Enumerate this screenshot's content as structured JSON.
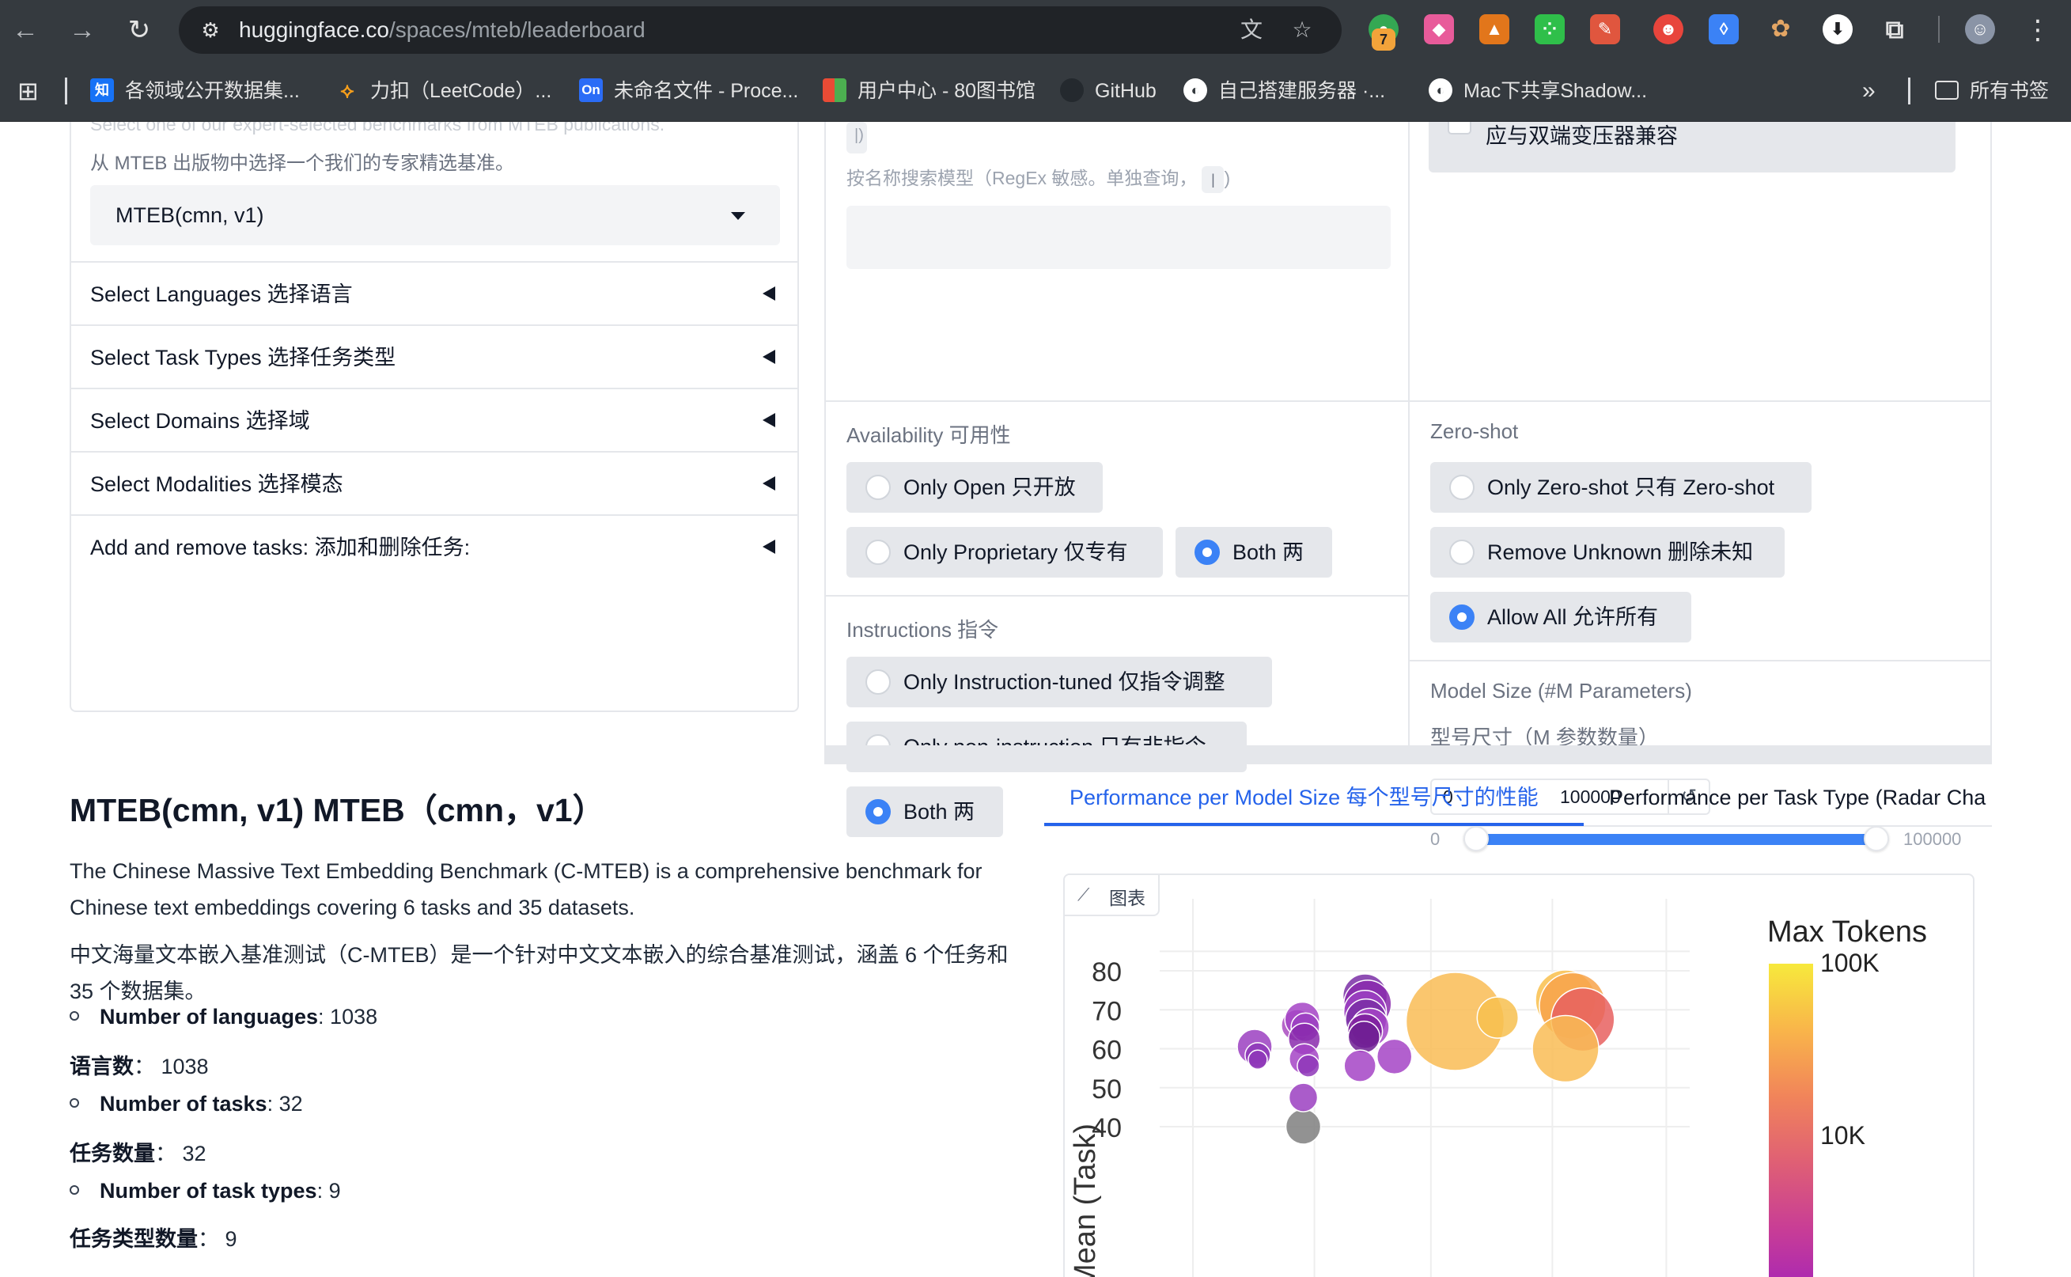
{
  "browser": {
    "url_host": "huggingface.co",
    "url_path": "/spaces/mteb/leaderboard",
    "extension_badge": "7",
    "bookmarks": [
      {
        "label": "各领域公开数据集...",
        "icon": "知",
        "color": "#1772f6"
      },
      {
        "label": "力扣（LeetCode）...",
        "icon": "⟡",
        "color": "#f89f1b"
      },
      {
        "label": "未命名文件 - Proce...",
        "icon": "On",
        "color": "#2b6cf6"
      },
      {
        "label": "用户中心 - 80图书馆",
        "icon": "▦",
        "color": "#e94b35"
      },
      {
        "label": "GitHub",
        "icon": "●",
        "color": "#24292e"
      },
      {
        "label": "自己搭建服务器 ·...",
        "icon": "◐",
        "color": "#ffffff"
      },
      {
        "label": "Mac下共享Shadow...",
        "icon": "◐",
        "color": "#ffffff"
      }
    ],
    "all_bookmarks": "所有书签"
  },
  "left": {
    "faded_info": "Select one of our expert-selected benchmarks from MTEB publications.",
    "info_cn": "从 MTEB 出版物中选择一个我们的专家精选基准。",
    "benchmark_value": "MTEB(cmn, v1)",
    "accordions": [
      "Select Languages  选择语言",
      "Select Task Types  选择任务类型",
      "Select Domains  选择域",
      "Select Modalities  选择模态",
      "Add and remove tasks:  添加和删除任务:"
    ]
  },
  "filters": {
    "search_info": "按名称搜索模型（RegEx 敏感。单独查询，",
    "search_kbd": "|",
    "search_tail": ")",
    "compat_label": "应与双端变压器兼容",
    "availability": {
      "label": "Availability  可用性",
      "options": [
        "Only Open  只开放",
        "Only Proprietary  仅专有",
        "Both  两"
      ],
      "selected": "Both  两"
    },
    "instructions": {
      "label": "Instructions  指令",
      "options": [
        "Only Instruction-tuned  仅指令调整",
        "Only non-instruction  只有非指令",
        "Both  两"
      ],
      "selected": "Both  两"
    },
    "zeroshot": {
      "label": "Zero-shot",
      "options": [
        "Only Zero-shot  只有 Zero-shot",
        "Remove Unknown  删除未知",
        "Allow All  允许所有"
      ],
      "selected": "Allow All  允许所有"
    },
    "model_size": {
      "label": "Model Size (#M Parameters)",
      "label_cn": "型号尺寸（M 参数数量）",
      "min": "0",
      "max": "100000",
      "slider_min_label": "0",
      "slider_max_label": "100000"
    }
  },
  "content": {
    "title": "MTEB(cmn, v1)  MTEB（cmn，v1）",
    "desc_en": "The Chinese Massive Text Embedding Benchmark (C-MTEB) is a comprehensive benchmark for Chinese text embeddings covering 6 tasks and 35 datasets.",
    "desc_cn": "中文海量文本嵌入基准测试（C-MTEB）是一个针对中文文本嵌入的综合基准测试，涵盖 6 个任务和 35 个数据集。",
    "stats": [
      {
        "label": "Number of languages",
        "value": ": 1038",
        "cn_label": "语言数",
        "cn_value": "： 1038"
      },
      {
        "label": "Number of tasks",
        "value": ": 32",
        "cn_label": "任务数量",
        "cn_value": "： 32"
      },
      {
        "label": "Number of task types",
        "value": ": 9",
        "cn_label": "任务类型数量",
        "cn_value": "： 9"
      }
    ]
  },
  "tabs": [
    {
      "label": "Performance per Model Size  每个型号尺寸的性能",
      "active": true
    },
    {
      "label": "Performance per Task Type (Radar Cha",
      "active": false
    }
  ],
  "chart_badge": "图表",
  "chart_data": {
    "type": "scatter",
    "ylabel": "Mean (Task)",
    "yticks": [
      40,
      50,
      60,
      70,
      80
    ],
    "ylim": [
      32,
      86
    ],
    "colorbar": {
      "title": "Max Tokens",
      "ticks": [
        "100K",
        "10K"
      ],
      "colors": [
        "#f7e93c",
        "#f9b54a",
        "#f1845a",
        "#df5f75",
        "#c83d96",
        "#a524b8"
      ]
    },
    "points": [
      {
        "xf": 0.268,
        "y": 40,
        "r": 22,
        "color": "#7f7f7f"
      },
      {
        "xf": 0.268,
        "y": 47.5,
        "r": 18,
        "color": "#9b3fc1"
      },
      {
        "xf": 0.172,
        "y": 60.5,
        "r": 22,
        "color": "#9b3fc1"
      },
      {
        "xf": 0.178,
        "y": 58.3,
        "r": 16,
        "color": "#8e37b9"
      },
      {
        "xf": 0.178,
        "y": 57.2,
        "r": 12,
        "color": "#8e37b9"
      },
      {
        "xf": 0.256,
        "y": 66,
        "r": 20,
        "color": "#a94bbf"
      },
      {
        "xf": 0.266,
        "y": 67.5,
        "r": 22,
        "color": "#a444c5"
      },
      {
        "xf": 0.272,
        "y": 65.5,
        "r": 18,
        "color": "#9b3fc1"
      },
      {
        "xf": 0.27,
        "y": 62.5,
        "r": 20,
        "color": "#8a2aad"
      },
      {
        "xf": 0.27,
        "y": 57.4,
        "r": 19,
        "color": "#a444c5"
      },
      {
        "xf": 0.278,
        "y": 55.6,
        "r": 14,
        "color": "#8e37b9"
      },
      {
        "xf": 0.39,
        "y": 73.5,
        "r": 28,
        "color": "#7a2fa6"
      },
      {
        "xf": 0.395,
        "y": 71.5,
        "r": 30,
        "color": "#8a2aad"
      },
      {
        "xf": 0.39,
        "y": 69.5,
        "r": 27,
        "color": "#9b3fc1"
      },
      {
        "xf": 0.392,
        "y": 67.5,
        "r": 26,
        "color": "#7a2fa6"
      },
      {
        "xf": 0.4,
        "y": 65.5,
        "r": 24,
        "color": "#a444c5"
      },
      {
        "xf": 0.39,
        "y": 64.5,
        "r": 22,
        "color": "#7d1f9c"
      },
      {
        "xf": 0.388,
        "y": 63,
        "r": 20,
        "color": "#6f1e93"
      },
      {
        "xf": 0.38,
        "y": 55.6,
        "r": 20,
        "color": "#a444c5"
      },
      {
        "xf": 0.448,
        "y": 58,
        "r": 22,
        "color": "#a444c5"
      },
      {
        "xf": 0.568,
        "y": 67,
        "r": 62,
        "color": "#f9bc55"
      },
      {
        "xf": 0.652,
        "y": 68,
        "r": 26,
        "color": "#f7c04f"
      },
      {
        "xf": 0.786,
        "y": 72.5,
        "r": 38,
        "color": "#f9c04c"
      },
      {
        "xf": 0.8,
        "y": 71,
        "r": 42,
        "color": "#f7a34b"
      },
      {
        "xf": 0.82,
        "y": 67.5,
        "r": 40,
        "color": "#e8605f"
      },
      {
        "xf": 0.786,
        "y": 60,
        "r": 42,
        "color": "#f9bc55"
      }
    ]
  }
}
